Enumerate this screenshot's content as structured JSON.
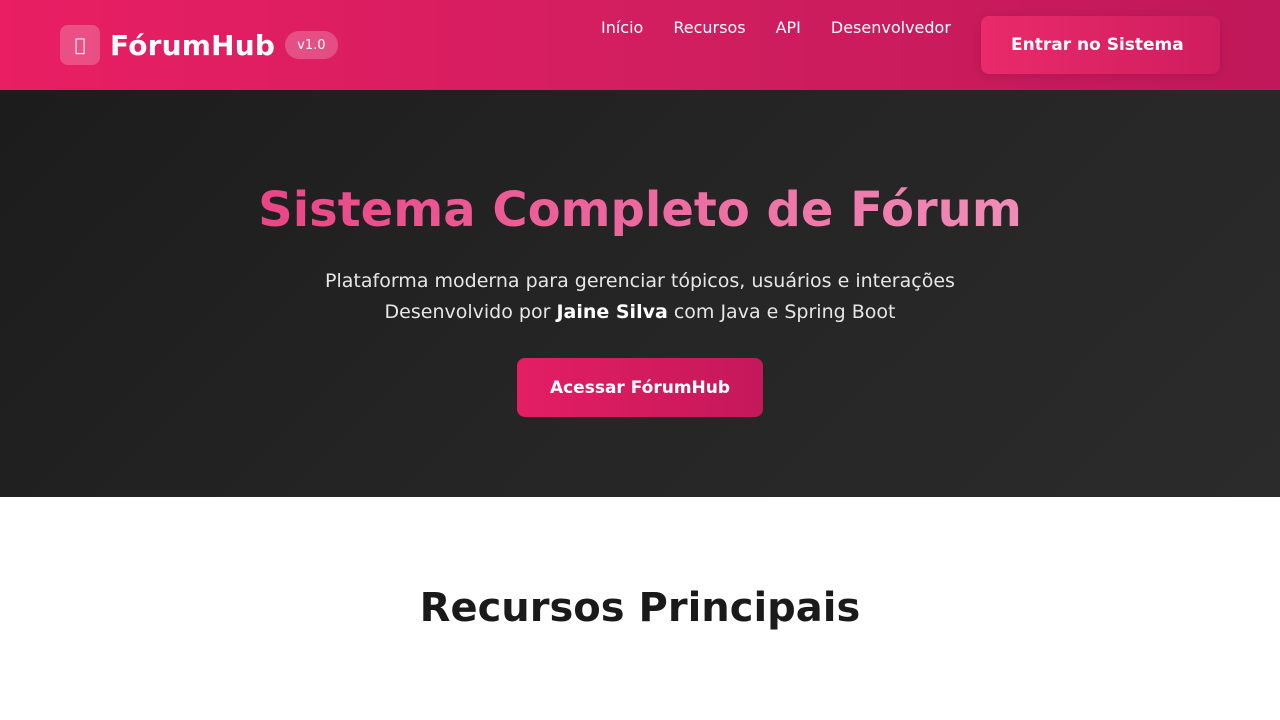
{
  "header": {
    "logo_icon": "",
    "logo_icon_name": "chat-bubbles-icon",
    "brand": "FórumHub",
    "version": "v1.0",
    "nav": [
      {
        "label": "Início"
      },
      {
        "label": "Recursos"
      },
      {
        "label": "API"
      },
      {
        "label": "Desenvolvedor"
      }
    ],
    "login_label": "Entrar no Sistema"
  },
  "hero": {
    "title": "Sistema Completo de Fórum",
    "subtitle_line1": "Plataforma moderna para gerenciar tópicos, usuários e interações",
    "subtitle_prefix": "Desenvolvido por ",
    "author": "Jaine Silva",
    "subtitle_suffix": " com Java e Spring Boot",
    "cta_label": "Acessar FórumHub"
  },
  "features": {
    "title": "Recursos Principais"
  },
  "colors": {
    "brand_pink": "#e91e63",
    "brand_pink_dark": "#c0185a",
    "hero_bg": "#222222",
    "title_gradient_start": "#e94586",
    "title_gradient_end": "#f08cb8"
  }
}
